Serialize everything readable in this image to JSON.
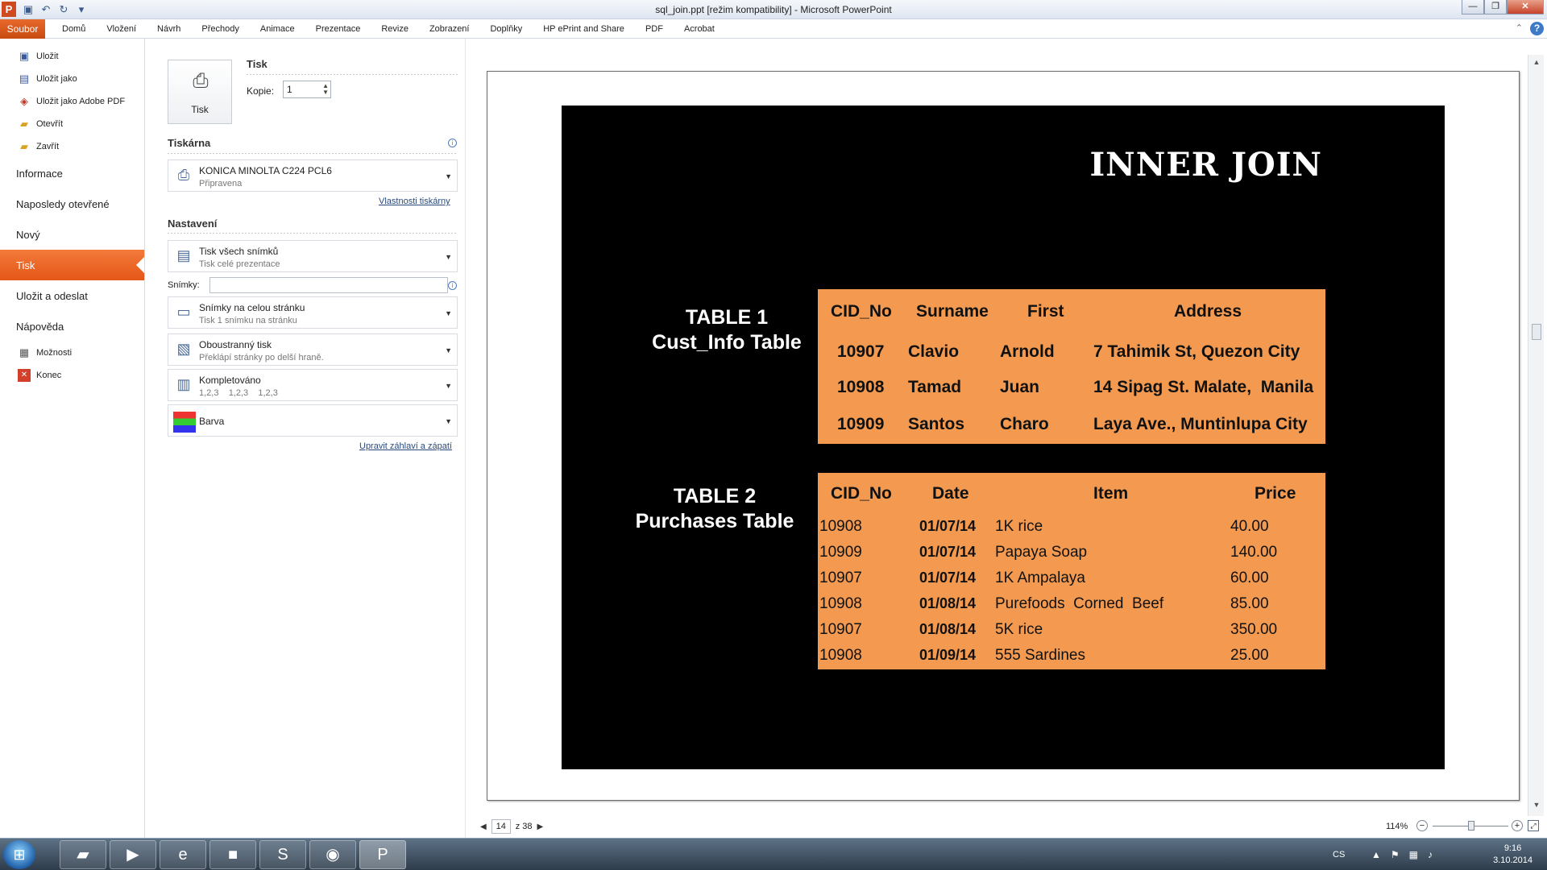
{
  "window": {
    "title": "sql_join.ppt [režim kompatibility] - Microsoft PowerPoint",
    "app_icon_letter": "P"
  },
  "ribbon": {
    "file_tab": "Soubor",
    "tabs": [
      "Domů",
      "Vložení",
      "Návrh",
      "Přechody",
      "Animace",
      "Prezentace",
      "Revize",
      "Zobrazení",
      "Doplňky",
      "HP ePrint and Share",
      "PDF",
      "Acrobat"
    ]
  },
  "backstage": {
    "commands_top": [
      {
        "label": "Uložit",
        "icon": "save-icon"
      },
      {
        "label": "Uložit jako",
        "icon": "save-as-icon"
      },
      {
        "label": "Uložit jako Adobe PDF",
        "icon": "pdf-icon"
      },
      {
        "label": "Otevřít",
        "icon": "open-folder-icon"
      },
      {
        "label": "Zavřít",
        "icon": "close-folder-icon"
      }
    ],
    "tabs": [
      "Informace",
      "Naposledy otevřené",
      "Nový",
      "Tisk",
      "Uložit a odeslat",
      "Nápověda"
    ],
    "active_tab": "Tisk",
    "commands_bottom": [
      {
        "label": "Možnosti",
        "icon": "options-icon"
      },
      {
        "label": "Konec",
        "icon": "exit-icon"
      }
    ]
  },
  "print": {
    "button_label": "Tisk",
    "section_title": "Tisk",
    "copies_label": "Kopie:",
    "copies_value": "1",
    "printer_section": "Tiskárna",
    "printer_name": "KONICA MINOLTA C224 PCL6",
    "printer_status": "Připravena",
    "printer_properties_link": "Vlastnosti tiskárny",
    "settings_section": "Nastavení",
    "range_main": "Tisk všech snímků",
    "range_sub": "Tisk celé prezentace",
    "slides_label": "Snímky:",
    "slides_value": "",
    "layout_main": "Snímky na celou stránku",
    "layout_sub": "Tisk 1 snímku na stránku",
    "duplex_main": "Oboustranný tisk",
    "duplex_sub": "Překlápí stránky po delší hraně.",
    "collate_main": "Kompletováno",
    "collate_sub": "1,2,3    1,2,3    1,2,3",
    "color_main": "Barva",
    "header_footer_link": "Upravit záhlaví a zápatí"
  },
  "slide": {
    "title": "INNER JOIN",
    "table1_label_line1": "TABLE 1",
    "table1_label_line2": "Cust_Info Table",
    "table2_label_line1": "TABLE 2",
    "table2_label_line2": "Purchases Table",
    "table1": {
      "headers": [
        "CID_No",
        "Surname",
        "First",
        "Address"
      ],
      "rows": [
        [
          "10907",
          "Clavio",
          "Arnold",
          "7 Tahimik St, Quezon City"
        ],
        [
          "10908",
          "Tamad",
          "Juan",
          "14 Sipag St. Malate,  Manila"
        ],
        [
          "10909",
          "Santos",
          "Charo",
          "Laya Ave., Muntinlupa City"
        ]
      ]
    },
    "table2": {
      "headers": [
        "CID_No",
        "Date",
        "Item",
        "Price"
      ],
      "rows": [
        [
          "10908",
          "01/07/14",
          "1K rice",
          "40.00"
        ],
        [
          "10909",
          "01/07/14",
          "Papaya Soap",
          "140.00"
        ],
        [
          "10907",
          "01/07/14",
          "1K Ampalaya",
          "60.00"
        ],
        [
          "10908",
          "01/08/14",
          "Purefoods  Corned  Beef",
          "85.00"
        ],
        [
          "10907",
          "01/08/14",
          "5K rice",
          "350.00"
        ],
        [
          "10908",
          "01/09/14",
          "555 Sardines",
          "25.00"
        ]
      ]
    }
  },
  "pager": {
    "current": "14",
    "of_total": "z 38"
  },
  "zoom": {
    "percent": "114%",
    "minus": "−",
    "plus": "+"
  },
  "taskbar": {
    "items": [
      "explorer-icon",
      "media-player-icon",
      "internet-explorer-icon",
      "cmd-icon",
      "skype-icon",
      "chrome-icon",
      "powerpoint-icon"
    ],
    "active": "powerpoint-icon",
    "lang": "CS",
    "time": "9:16",
    "date": "3.10.2014"
  }
}
